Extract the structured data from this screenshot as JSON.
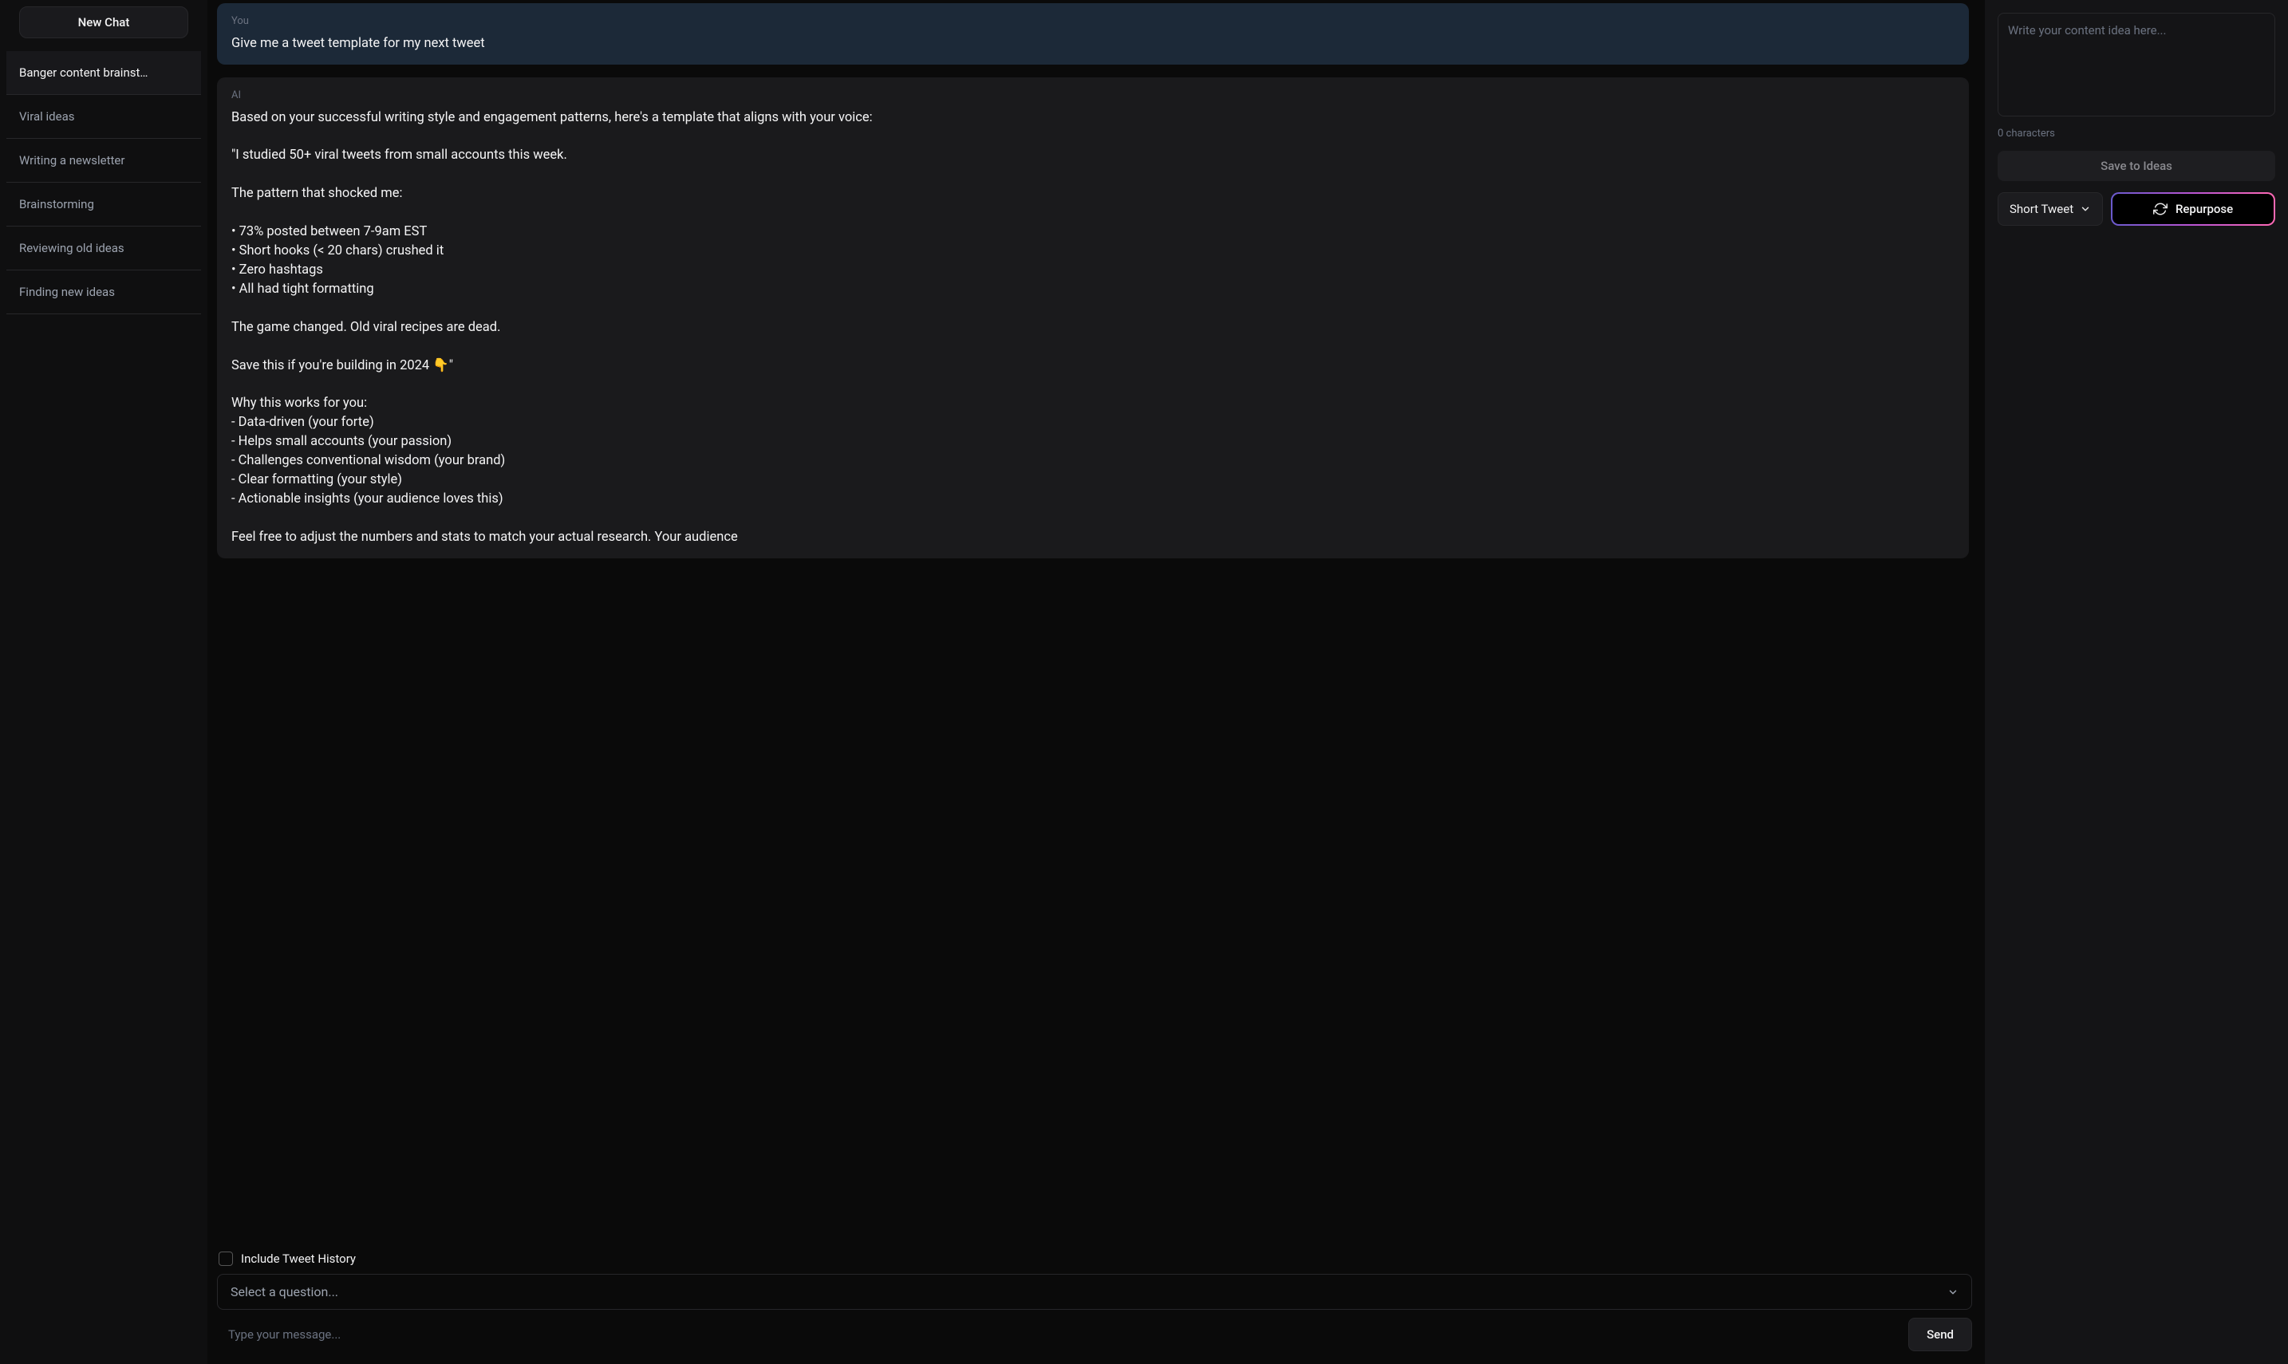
{
  "sidebar": {
    "new_chat_label": "New Chat",
    "active_index": 0,
    "items": [
      {
        "label": "Banger content brainst…"
      },
      {
        "label": "Viral ideas"
      },
      {
        "label": "Writing a newsletter"
      },
      {
        "label": "Brainstorming"
      },
      {
        "label": "Reviewing old ideas"
      },
      {
        "label": "Finding new ideas"
      }
    ]
  },
  "chat": {
    "user": {
      "author": "You",
      "text": "Give me a tweet template for my next tweet"
    },
    "ai": {
      "author": "AI",
      "text": "Based on your successful writing style and engagement patterns, here's a template that aligns with your voice:\n\n\"I studied 50+ viral tweets from small accounts this week.\n\nThe pattern that shocked me:\n\n• 73% posted between 7-9am EST\n• Short hooks (< 20 chars) crushed it\n• Zero hashtags\n• All had tight formatting\n\nThe game changed. Old viral recipes are dead.\n\nSave this if you're building in 2024 👇\"\n\nWhy this works for you:\n- Data-driven (your forte)\n- Helps small accounts (your passion)\n- Challenges conventional wisdom (your brand)\n- Clear formatting (your style)\n- Actionable insights (your audience loves this)\n\nFeel free to adjust the numbers and stats to match your actual research. Your audience"
    },
    "include_history_label": "Include Tweet History",
    "include_history_checked": false,
    "question_placeholder": "Select a question...",
    "message_placeholder": "Type your message...",
    "send_label": "Send"
  },
  "right_panel": {
    "idea_placeholder": "Write your content idea here...",
    "char_count": "0 characters",
    "save_label": "Save to Ideas",
    "format_label": "Short Tweet",
    "repurpose_label": "Repurpose"
  },
  "icons": {
    "chevron_down": "chevron-down-icon",
    "refresh": "refresh-icon"
  }
}
